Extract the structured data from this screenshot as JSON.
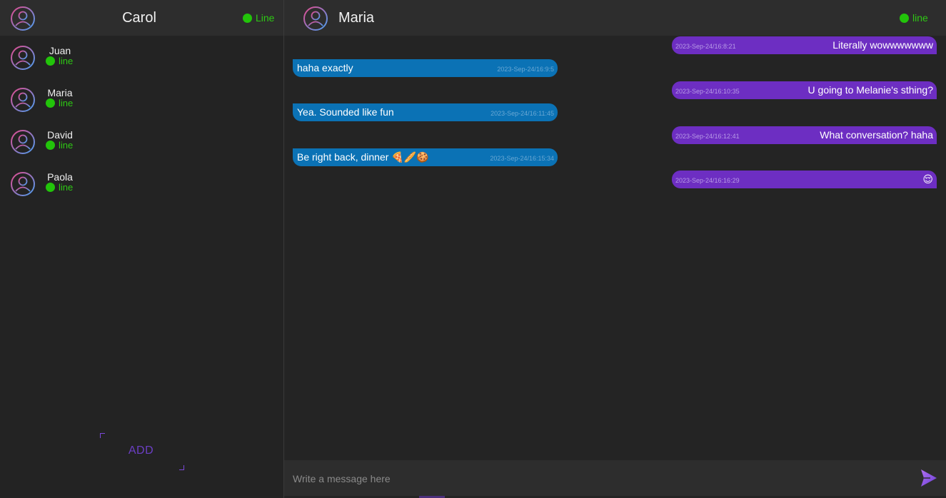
{
  "me": {
    "name": "Carol",
    "status": "Line",
    "avatar_icon": "user-circle-icon"
  },
  "contacts": [
    {
      "name": "Juan",
      "status": "line"
    },
    {
      "name": "Maria",
      "status": "line"
    },
    {
      "name": "David",
      "status": "line"
    },
    {
      "name": "Paola",
      "status": "line"
    }
  ],
  "add_button": {
    "label": "ADD"
  },
  "chat": {
    "name": "Maria",
    "status": "line"
  },
  "messages": [
    {
      "direction": "sent",
      "time": "2023-Sep-24/16:8:21",
      "text": "Literally wowwwwwww"
    },
    {
      "direction": "recv",
      "time": "2023-Sep-24/16:9:5",
      "text": "haha exactly"
    },
    {
      "direction": "sent",
      "time": "2023-Sep-24/16:10:35",
      "text": "U going to Melanie's sthing?"
    },
    {
      "direction": "recv",
      "time": "2023-Sep-24/16:11:45",
      "text": "Yea. Sounded like fun"
    },
    {
      "direction": "sent",
      "time": "2023-Sep-24/16:12:41",
      "text": "What conversation? haha"
    },
    {
      "direction": "recv",
      "time": "2023-Sep-24/16:15:34",
      "text": "Be right back, dinner 🍕🥖🍪"
    },
    {
      "direction": "sent",
      "time": "2023-Sep-24/16:16:29",
      "text": "😌"
    }
  ],
  "composer": {
    "placeholder": "Write a message here",
    "value": "",
    "send_icon": "send-icon"
  },
  "colors": {
    "accent_purple": "#6d2ec2",
    "incoming_blue": "#0b72b5",
    "online_green": "#22c40a",
    "background": "#242424",
    "header": "#2d2d2d"
  }
}
